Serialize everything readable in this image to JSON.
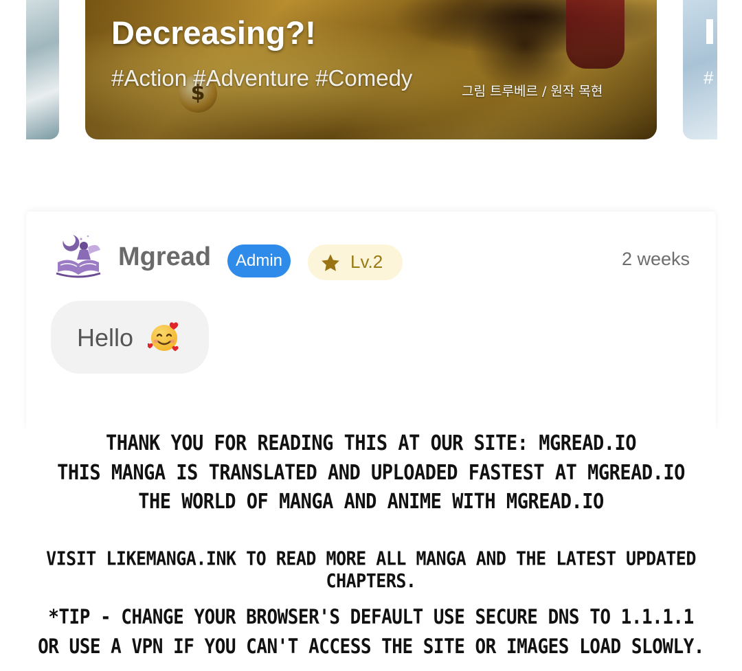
{
  "carousel": {
    "main": {
      "title": "Decreasing?!",
      "tags": "#Action #Adventure #Comedy",
      "credit": "그림 트루베르 / 원작 목현",
      "coin_symbol": "$"
    },
    "right_peek": {
      "title_peek": "L",
      "tags_peek": "#"
    }
  },
  "comment": {
    "username": "Mgread",
    "role_badge": "Admin",
    "level_badge": "Lv.2",
    "timestamp": "2 weeks",
    "message": "Hello",
    "emoji": "smiling-face-with-hearts",
    "avatar_icon": "fairy-reading-book-icon",
    "colors": {
      "admin_badge_bg": "#2f8be9",
      "level_badge_bg": "#fcf5d9",
      "level_text": "#9a7a12",
      "bubble_bg": "#f2f2f2"
    }
  },
  "notices": {
    "line1": "Thank you for reading this at our site: mgread.io",
    "line2": "This manga is translated and uploaded fastest at mgread.io",
    "line3": "The world of manga and anime with mgread.io",
    "line4": "Visit likemanga.ink to read more all manga and the latest updated chapters.",
    "line5": "*Tip - Change your browser's default use secure DNS to 1.1.1.1",
    "line6": "or use a VPN if you can't access the site or images load slowly."
  }
}
